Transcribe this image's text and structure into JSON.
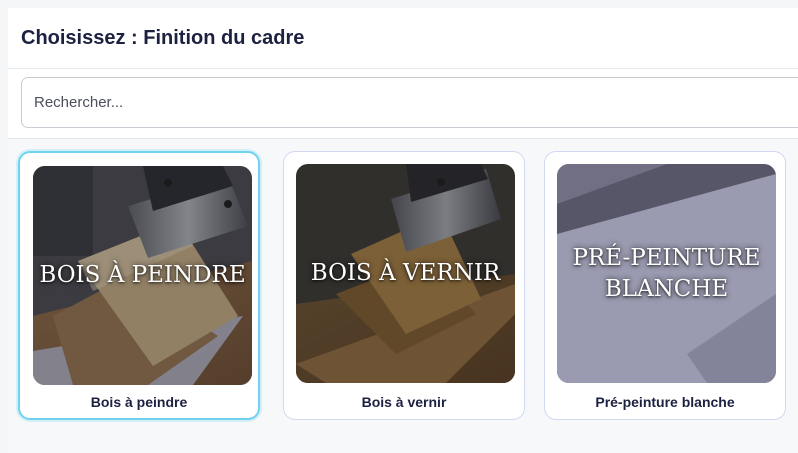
{
  "header": {
    "title": "Choisissez : Finition du cadre"
  },
  "search": {
    "placeholder": "Rechercher..."
  },
  "options": [
    {
      "overlay": "BOIS À PEINDRE",
      "label": "Bois à peindre",
      "selected": true
    },
    {
      "overlay": "BOIS À VERNIR",
      "label": "Bois à vernir",
      "selected": false
    },
    {
      "overlay": "PRÉ-PEINTURE BLANCHE",
      "label": "Pré-peinture blanche",
      "selected": false
    }
  ],
  "colors": {
    "title": "#1c2140",
    "selected_border": "#6fd3f0",
    "card_border": "#d2d8f2"
  }
}
